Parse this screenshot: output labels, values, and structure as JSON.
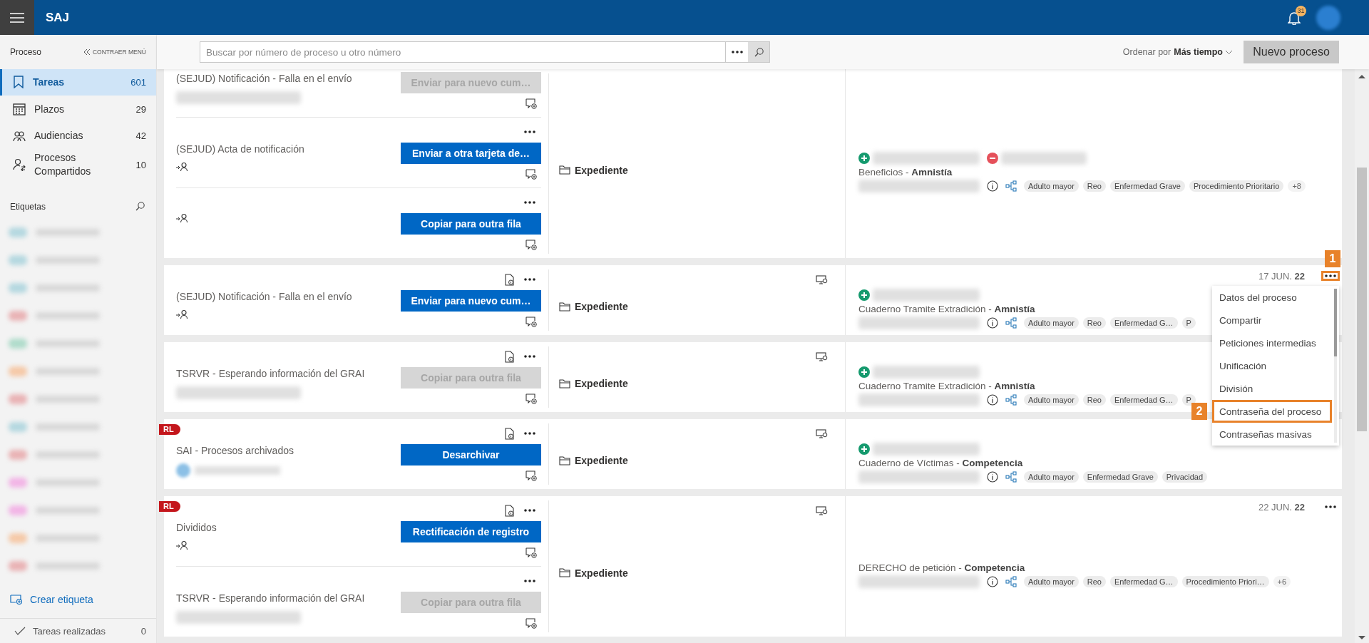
{
  "app": {
    "title": "SAJ",
    "notifications": "31"
  },
  "sidebar": {
    "header": "Proceso",
    "collapse_label": "CONTRAER MENÚ",
    "nav": [
      {
        "label": "Tareas",
        "count": "601",
        "selected": true
      },
      {
        "label": "Plazos",
        "count": "29",
        "selected": false
      },
      {
        "label": "Audiencias",
        "count": "42",
        "selected": false
      },
      {
        "label": "Procesos Compartidos",
        "count": "10",
        "selected": false
      }
    ],
    "labels_title": "Etiquetas",
    "labels": [
      {
        "color": "#b5d8e0"
      },
      {
        "color": "#b5d8e0"
      },
      {
        "color": "#b5d8e0"
      },
      {
        "color": "#e9b3b5"
      },
      {
        "color": "#b0dccb"
      },
      {
        "color": "#f5c9a8"
      },
      {
        "color": "#e9b3b5"
      },
      {
        "color": "#b5d8e0"
      },
      {
        "color": "#e9b3b5"
      },
      {
        "color": "#f2b5e6"
      },
      {
        "color": "#f2b5e6"
      },
      {
        "color": "#f5c9a8"
      },
      {
        "color": "#e9b3b5"
      }
    ],
    "create_label": "Crear etiqueta",
    "done": {
      "label": "Tareas realizadas",
      "count": "0"
    }
  },
  "toolbar": {
    "search": {
      "placeholder": "Buscar por número de proceso u otro número"
    },
    "sort_prefix": "Ordenar por",
    "sort_value": "Más tiempo",
    "new_button": "Nuevo proceso"
  },
  "cards": [
    {
      "tasks": [
        {
          "title": "(SEJUD) Notificación - Falla en el envío",
          "kind": "blurred",
          "action": "Enviar para nuevo cum…",
          "disabled": true,
          "doc_icon": false,
          "menu": false
        },
        {
          "title": "(SEJUD) Acta de notificación",
          "kind": "assign",
          "action": "Enviar a otra tarjeta de…",
          "disabled": false,
          "doc_icon": false,
          "menu": true
        },
        {
          "kind": "assign",
          "action": "Copiar para outra fila",
          "disabled": false,
          "doc_icon": false,
          "menu": true
        }
      ],
      "file": "Expediente",
      "monitor_icon": false,
      "parties": [
        {
          "kind": "add"
        },
        {
          "kind": "remove"
        }
      ],
      "title": "Beneficios - **Amnistía**",
      "tags": [
        "Adulto mayor",
        "Reo",
        "Enfermedad Grave",
        "Procedimiento Prioritario"
      ],
      "more_tags": "+8"
    },
    {
      "tasks": [
        {
          "title": "(SEJUD) Notificación - Falla en el envío",
          "kind": "assign",
          "action": "Enviar para nuevo cum…",
          "disabled": false,
          "doc_icon": true,
          "menu": true
        }
      ],
      "file": "Expediente",
      "monitor_icon": true,
      "date": "17 JUN. **22**",
      "menu_button": true,
      "menu_callout": "1",
      "dropdown": [
        {
          "label": "Datos del proceso"
        },
        {
          "label": "Compartir"
        },
        {
          "label": "Peticiones intermedias"
        },
        {
          "label": "Unificación"
        },
        {
          "label": "División"
        },
        {
          "label": "Contraseña del proceso",
          "callout": "2"
        },
        {
          "label": "Contraseñas masivas"
        }
      ],
      "parties": [
        {
          "kind": "add"
        }
      ],
      "title": "Cuaderno Tramite Extradición - **Amnistía**",
      "tags": [
        "Adulto mayor",
        "Reo",
        "Enfermedad G…",
        "P"
      ]
    },
    {
      "tasks": [
        {
          "title": "TSRVR - Esperando información del GRAI",
          "kind": "blurred",
          "action": "Copiar para outra fila",
          "disabled": true,
          "doc_icon": true,
          "menu": true
        }
      ],
      "file": "Expediente",
      "monitor_icon": true,
      "parties": [
        {
          "kind": "add"
        }
      ],
      "title": "Cuaderno Tramite Extradición - **Amnistía**",
      "tags": [
        "Adulto mayor",
        "Reo",
        "Enfermedad G…",
        "P"
      ]
    },
    {
      "ribbon": "RL",
      "tasks": [
        {
          "title": "SAI - Procesos archivados",
          "kind": "person",
          "action": "Desarchivar",
          "disabled": false,
          "doc_icon": true,
          "menu": true
        }
      ],
      "file": "Expediente",
      "monitor_icon": true,
      "parties": [
        {
          "kind": "add"
        }
      ],
      "title": "Cuaderno de Víctimas - **Competencia**",
      "tags": [
        "Adulto mayor",
        "Enfermedad Grave",
        "Privacidad"
      ]
    },
    {
      "ribbon": "RL",
      "tasks": [
        {
          "title": "Divididos",
          "kind": "assign",
          "action": "Rectificación de registro",
          "disabled": false,
          "doc_icon": true,
          "menu": true
        },
        {
          "title": "TSRVR - Esperando información del GRAI",
          "kind": "blurred",
          "action": "Copiar para outra fila",
          "disabled": true,
          "doc_icon": false,
          "menu": true
        }
      ],
      "file": "Expediente",
      "monitor_icon": true,
      "date": "22 JUN. **22**",
      "menu_button": true,
      "title": "DERECHO de petición - **Competencia**",
      "tags": [
        "Adulto mayor",
        "Reo",
        "Enfermedad G…",
        "Procedimiento Priori…"
      ],
      "more_tags": "+6"
    }
  ]
}
